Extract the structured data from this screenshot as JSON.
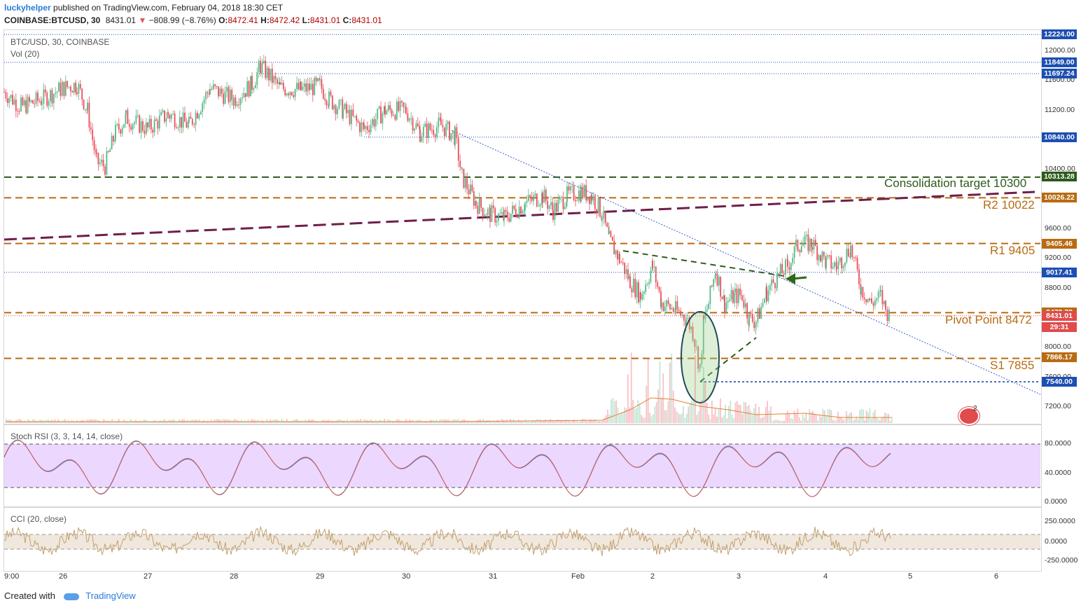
{
  "header": {
    "user": "luckyhelper",
    "published": "published on TradingView.com, February 04, 2018 18:30 CET"
  },
  "symbol_line": {
    "symbol": "COINBASE:BTCUSD, 30",
    "last": "8431.01",
    "change": "−808.99 (−8.76%)",
    "o_label": "O:",
    "o": "8472.41",
    "h_label": "H:",
    "h": "8472.42",
    "l_label": "L:",
    "l": "8431.01",
    "c_label": "C:",
    "c": "8431.01"
  },
  "main_panel": {
    "title": "BTC/USD, 30, COINBASE",
    "vol_label": "Vol (20)"
  },
  "stoch_panel": {
    "title": "Stoch RSI (3, 3, 14, 14, close)",
    "ticks": [
      "80.0000",
      "40.0000",
      "0.0000"
    ]
  },
  "cci_panel": {
    "title": "CCI (20, close)",
    "ticks": [
      "250.0000",
      "0.0000",
      "-250.0000"
    ]
  },
  "price_ticks": [
    "12000.00",
    "11600.00",
    "11200.00",
    "10400.00",
    "9600.00",
    "9200.00",
    "8800.00",
    "8000.00",
    "7600.00",
    "7200.00"
  ],
  "price_labels": [
    {
      "text": "12224.00",
      "color": "#1c4fb3"
    },
    {
      "text": "11849.00",
      "color": "#1c4fb3"
    },
    {
      "text": "11697.24",
      "color": "#1c4fb3"
    },
    {
      "text": "10840.00",
      "color": "#1c4fb3"
    },
    {
      "text": "10313.28",
      "color": "#2d5a1b"
    },
    {
      "text": "10026.22",
      "color": "#b86b12"
    },
    {
      "text": "9405.46",
      "color": "#b86b12"
    },
    {
      "text": "9017.41",
      "color": "#1c4fb3"
    },
    {
      "text": "8472.72",
      "color": "#b86b12"
    },
    {
      "text": "8431.01",
      "color": "#e04b4b"
    },
    {
      "text": "29:31",
      "color": "#e04b4b"
    },
    {
      "text": "7866.17",
      "color": "#b86b12"
    },
    {
      "text": "7540.00",
      "color": "#1c4fb3"
    }
  ],
  "annotations": {
    "consolidation": "Consolidation target 10300",
    "r2": "R2 10022",
    "r1": "R1 9405",
    "pivot": "Pivot Point 8472",
    "s1": "S1 7855"
  },
  "x_ticks": [
    "9:00",
    "26",
    "27",
    "28",
    "29",
    "30",
    "31",
    "Feb",
    "2",
    "3",
    "4",
    "5",
    "6"
  ],
  "footer": {
    "created": "Created with",
    "brand": "TradingView"
  },
  "flag_badge": "2",
  "chart_data": {
    "type": "candlestick",
    "title": "BTC/USD, 30, COINBASE",
    "ylim": [
      7000,
      12300
    ],
    "x_start": "Jan 25 2018",
    "x_end": "Feb 6 2018",
    "levels": [
      {
        "name": "Consolidation target",
        "value": 10300
      },
      {
        "name": "R2",
        "value": 10022
      },
      {
        "name": "R1",
        "value": 9405
      },
      {
        "name": "Pivot Point",
        "value": 8472
      },
      {
        "name": "S1",
        "value": 7855
      }
    ],
    "close_path": [
      {
        "day": "Jan 25",
        "close": 11500
      },
      {
        "day": "Jan 26 06:00",
        "close": 10400
      },
      {
        "day": "Jan 27",
        "close": 11000
      },
      {
        "day": "Jan 28",
        "close": 11700
      },
      {
        "day": "Jan 29",
        "close": 11550
      },
      {
        "day": "Jan 30",
        "close": 11000
      },
      {
        "day": "Jan 31",
        "close": 9950
      },
      {
        "day": "Feb 1",
        "close": 10100
      },
      {
        "day": "Feb 2",
        "close": 8600
      },
      {
        "day": "Feb 2 12:00",
        "close": 7540
      },
      {
        "day": "Feb 3",
        "close": 8500
      },
      {
        "day": "Feb 4",
        "close": 9300
      },
      {
        "day": "Feb 4 18:30",
        "close": 8431
      }
    ],
    "last": {
      "open": 8472.41,
      "high": 8472.42,
      "low": 8431.01,
      "close": 8431.01
    }
  }
}
